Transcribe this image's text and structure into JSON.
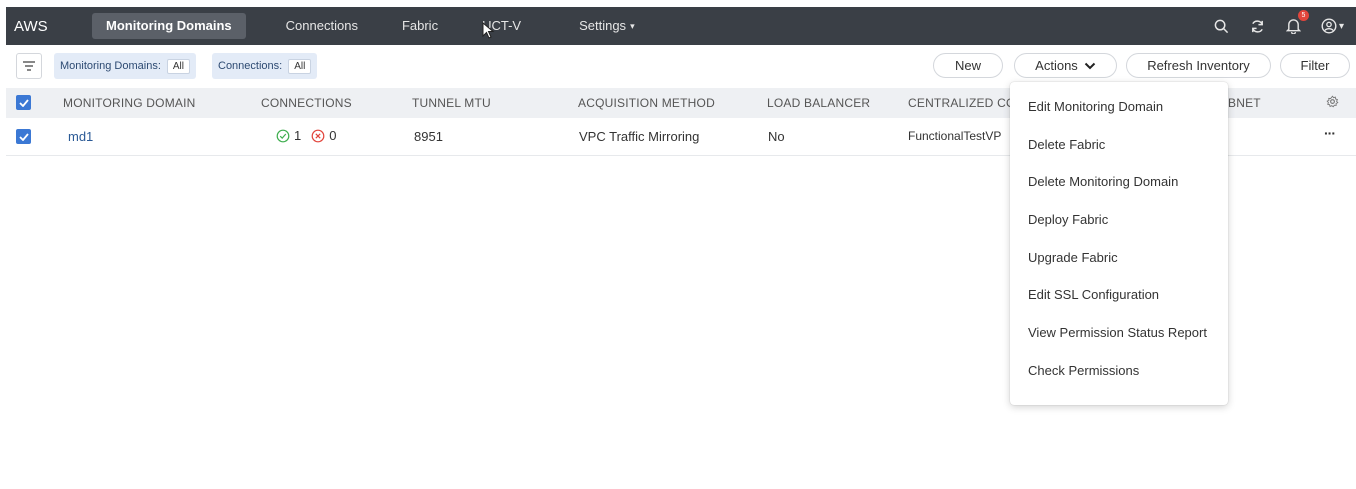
{
  "topbar": {
    "brand": "AWS",
    "nav": [
      "Monitoring Domains",
      "Connections",
      "Fabric",
      "UCT-V",
      "Settings"
    ],
    "active_index": 0,
    "notification_count": "5"
  },
  "filters": [
    {
      "label": "Monitoring Domains:",
      "value": "All"
    },
    {
      "label": "Connections:",
      "value": "All"
    }
  ],
  "buttons": {
    "new": "New",
    "actions": "Actions",
    "refresh": "Refresh Inventory",
    "filter": "Filter"
  },
  "table": {
    "headers": [
      "MONITORING DOMAIN",
      "CONNECTIONS",
      "TUNNEL MTU",
      "ACQUISITION METHOD",
      "LOAD BALANCER",
      "CENTRALIZED CO",
      "BNET"
    ],
    "rows": [
      {
        "domain": "md1",
        "connections_ok": "1",
        "connections_err": "0",
        "mtu": "8951",
        "method": "VPC Traffic Mirroring",
        "load_balancer": "No",
        "centralized": "FunctionalTestVP",
        "more": "···"
      }
    ]
  },
  "actions_menu": [
    "Edit Monitoring Domain",
    "Delete Fabric",
    "Delete Monitoring Domain",
    "Deploy Fabric",
    "Upgrade Fabric",
    "Edit SSL Configuration",
    "View Permission Status Report",
    "Check Permissions"
  ],
  "colors": {
    "topbar": "#3a3f46",
    "accent": "#3b78d4",
    "ok": "#3fae4f",
    "error": "#e2453c"
  },
  "icons": [
    "search-icon",
    "refresh-icon",
    "bell-icon",
    "user-icon",
    "filter-lines-icon",
    "settings-gear-icon",
    "check-circle-icon",
    "x-circle-icon",
    "chevron-down-icon"
  ]
}
